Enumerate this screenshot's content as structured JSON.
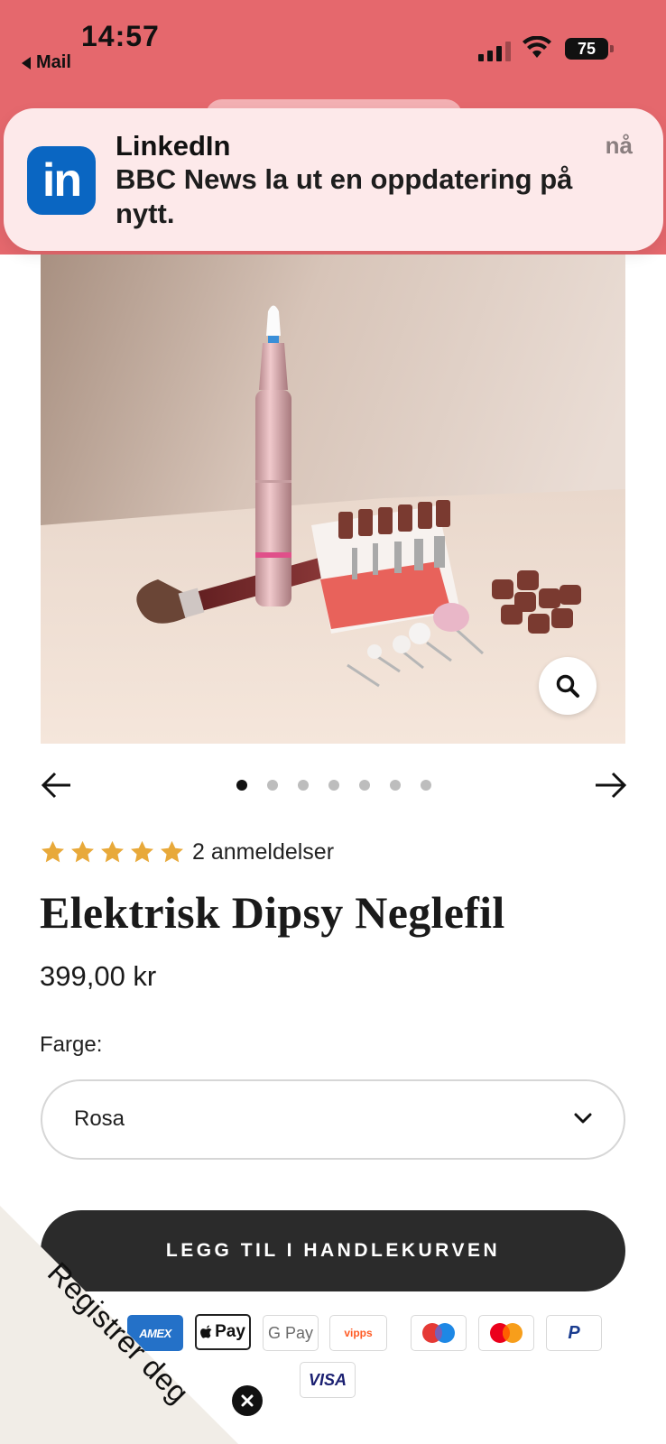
{
  "status_bar": {
    "time": "14:57",
    "back_app": "Mail",
    "battery": "75"
  },
  "notification": {
    "app": "LinkedIn",
    "logo_text": "in",
    "message": "BBC News la ut en oppdatering på nytt.",
    "time": "nå"
  },
  "product": {
    "image_icon": "product-photo-nail-drill",
    "zoom_icon": "search-icon",
    "carousel": {
      "total": 7,
      "active_index": 0
    },
    "rating_stars": 5,
    "review_count": "2 anmeldelser",
    "title": "Elektrisk Dipsy Neglefil",
    "price": "399,00 kr",
    "color_label": "Farge:",
    "color_value": "Rosa",
    "add_to_cart": "LEGG TIL I HANDLEKURVEN"
  },
  "payment_methods": {
    "amex": "AMEX",
    "apple_pay": "Pay",
    "google_pay": "G Pay",
    "vipps": "vipps",
    "maestro": "maestro-icon",
    "mastercard": "mastercard-icon",
    "paypal": "P",
    "visa": "VISA"
  },
  "register_popup": {
    "label": "Registrer deg"
  },
  "colors": {
    "status_band": "#e5686d",
    "notification_bg": "#fde9ea",
    "linkedin_blue": "#0a66c2",
    "button_dark": "#2b2b2b",
    "star_gold": "#e8a93a"
  }
}
